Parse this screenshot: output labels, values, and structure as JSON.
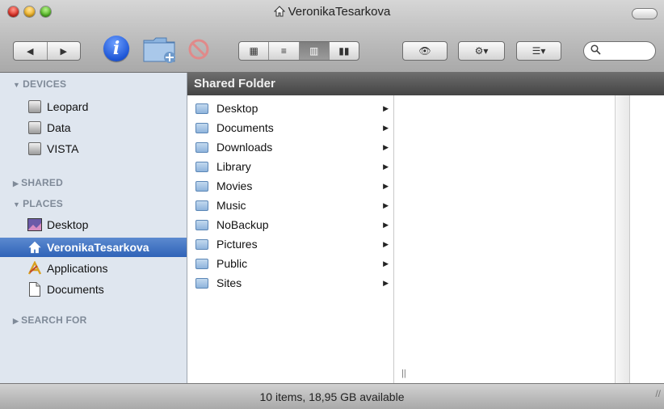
{
  "window": {
    "title": "VeronikaTesarkova"
  },
  "toolbar": {
    "back_icon": "◀",
    "forward_icon": "▶",
    "views": [
      "▦",
      "≡",
      "▥",
      "▮▮"
    ],
    "eye_icon": "👁",
    "gear_icon": "⚙▾",
    "arrange_icon": "☰▾",
    "search_placeholder": ""
  },
  "sidebar": {
    "devices_header": "DEVICES",
    "devices": [
      "Leopard",
      "Data",
      "VISTA"
    ],
    "shared_header": "SHARED",
    "places_header": "PLACES",
    "places": [
      "Desktop",
      "VeronikaTesarkova",
      "Applications",
      "Documents"
    ],
    "search_header": "SEARCH FOR"
  },
  "browser": {
    "header": "Shared Folder",
    "items": [
      "Desktop",
      "Documents",
      "Downloads",
      "Library",
      "Movies",
      "Music",
      "NoBackup",
      "Pictures",
      "Public",
      "Sites"
    ]
  },
  "status": {
    "text": "10 items, 18,95 GB available"
  },
  "colors": {
    "selection": "#2f63b8",
    "sidebar_bg": "#dfe6ef",
    "header_bg": "#555555"
  }
}
